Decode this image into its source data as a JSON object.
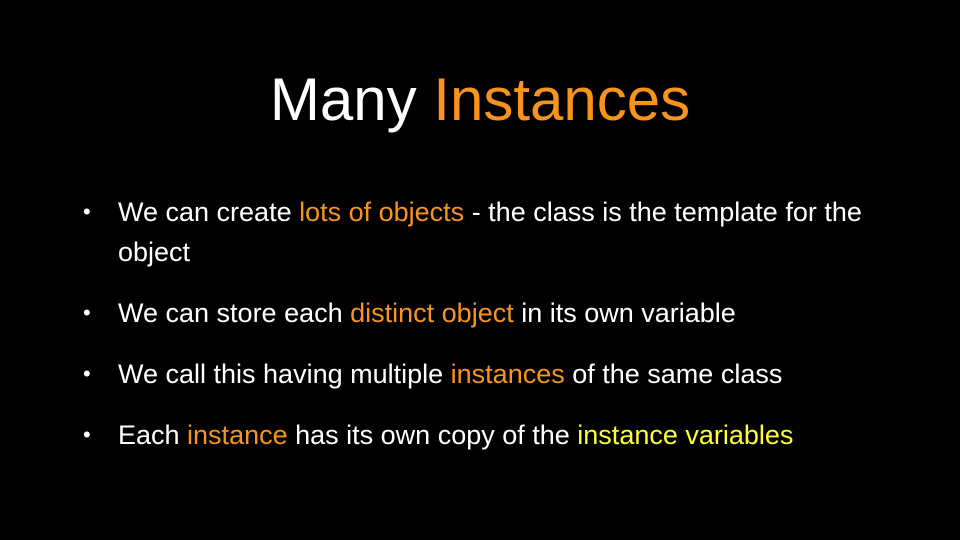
{
  "colors": {
    "background": "#000000",
    "text": "#ffffff",
    "accent_orange": "#f7941d",
    "accent_yellow": "#ffff33"
  },
  "title": {
    "part1": "Many ",
    "part2": "Instances"
  },
  "bullet_symbol": "•",
  "bullets": [
    {
      "segments": [
        {
          "text": "We can create ",
          "color": "white"
        },
        {
          "text": "lots of objects",
          "color": "orange"
        },
        {
          "text": " - the class is the template for the object",
          "color": "white"
        }
      ]
    },
    {
      "segments": [
        {
          "text": "We can store each ",
          "color": "white"
        },
        {
          "text": "distinct object",
          "color": "orange"
        },
        {
          "text": " in its own variable",
          "color": "white"
        }
      ]
    },
    {
      "segments": [
        {
          "text": "We call this having multiple ",
          "color": "white"
        },
        {
          "text": "instances",
          "color": "orange"
        },
        {
          "text": " of the same class",
          "color": "white"
        }
      ]
    },
    {
      "segments": [
        {
          "text": "Each ",
          "color": "white"
        },
        {
          "text": "instance",
          "color": "orange"
        },
        {
          "text": " has its own copy of the ",
          "color": "white"
        },
        {
          "text": "instance variables",
          "color": "yellow"
        }
      ]
    }
  ]
}
